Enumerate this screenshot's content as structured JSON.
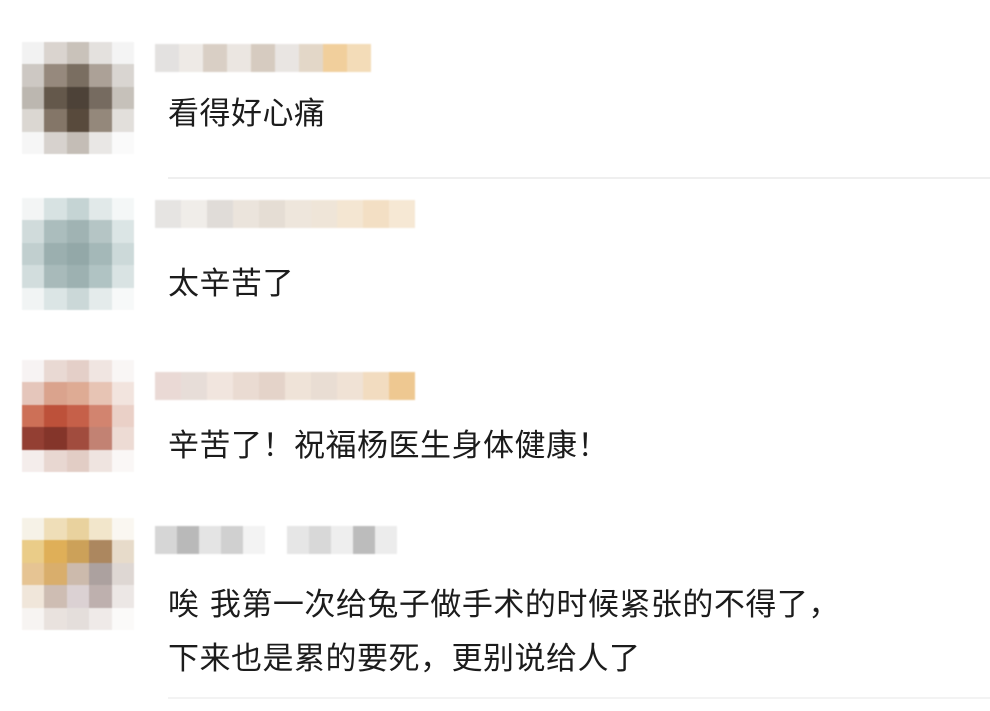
{
  "comments": [
    {
      "text": "看得好心痛"
    },
    {
      "text": "太辛苦了"
    },
    {
      "text": "辛苦了！祝福杨医生身体健康！"
    },
    {
      "text": "唉  我第一次给兔子做手术的时候紧张的不得了，\n下来也是累的要死，更别说给人了"
    }
  ]
}
